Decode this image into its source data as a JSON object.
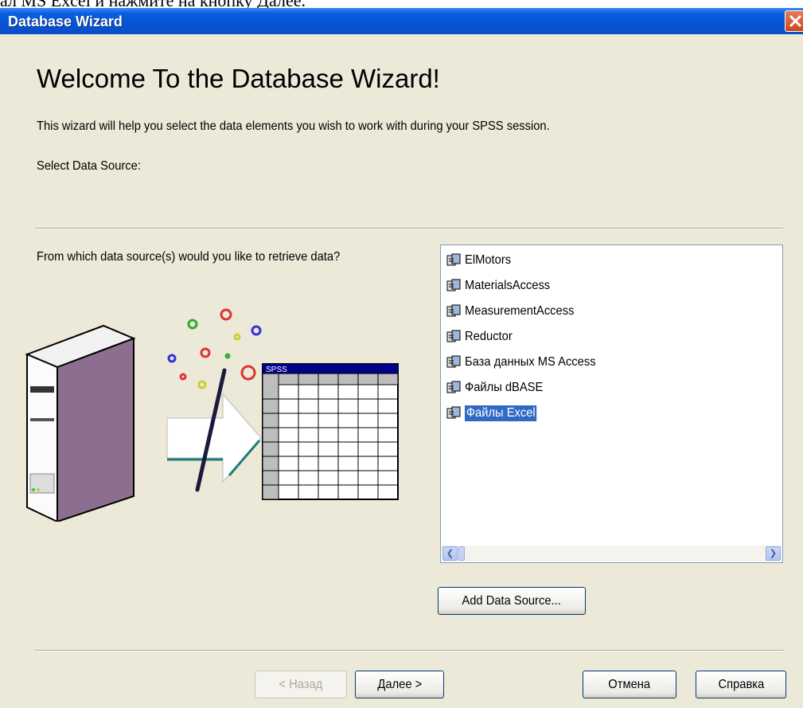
{
  "doc_fragment": "ал MS Excel и нажмите на кнопку Далее.",
  "window": {
    "title": "Database Wizard"
  },
  "heading": "Welcome To the Database Wizard!",
  "description": "This wizard will help you select the data elements you wish to work with during your SPSS session.",
  "select_label": "Select Data Source:",
  "question": "From which data source(s) would you like to retrieve data?",
  "illustration": {
    "spreadsheet_label": "SPSS"
  },
  "data_sources": [
    {
      "label": "ElMotors",
      "selected": false
    },
    {
      "label": "MaterialsAccess",
      "selected": false
    },
    {
      "label": "MeasurementAccess",
      "selected": false
    },
    {
      "label": "Reductor",
      "selected": false
    },
    {
      "label": "База данных MS Access",
      "selected": false
    },
    {
      "label": "Файлы dBASE",
      "selected": false
    },
    {
      "label": "Файлы Excel",
      "selected": true
    }
  ],
  "buttons": {
    "add_source": "Add Data Source...",
    "back": "< Назад",
    "next": "Далее >",
    "cancel": "Отмена",
    "help": "Справка"
  },
  "colors": {
    "titlebar": "#0553d6",
    "selection": "#316ac5",
    "dialog_bg": "#ece9d8"
  }
}
